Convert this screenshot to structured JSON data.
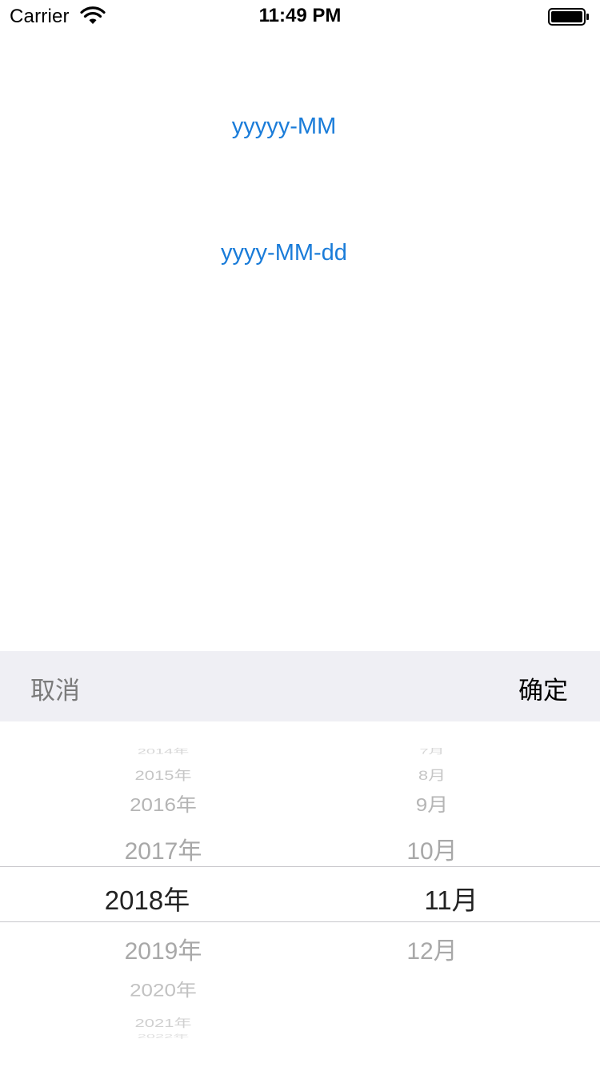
{
  "status_bar": {
    "carrier": "Carrier",
    "time": "11:49 PM"
  },
  "main": {
    "links": [
      {
        "label": "yyyyy-MM"
      },
      {
        "label": "yyyy-MM-dd"
      }
    ],
    "link_color": "#1a7cd9"
  },
  "picker": {
    "toolbar": {
      "cancel_label": "取消",
      "confirm_label": "确定",
      "background": "#efeff4"
    },
    "years": {
      "above3": "2014年",
      "above2": "2015年",
      "above1": "2016年",
      "above0": "2017年",
      "selected": "2018年",
      "below1": "2019年",
      "below2": "2020年",
      "below3": "2021年",
      "below4": "2022年"
    },
    "months": {
      "above3": "7月",
      "above2": "8月",
      "above1": "9月",
      "above0": "10月",
      "selected": "11月",
      "below1": "12月"
    }
  }
}
